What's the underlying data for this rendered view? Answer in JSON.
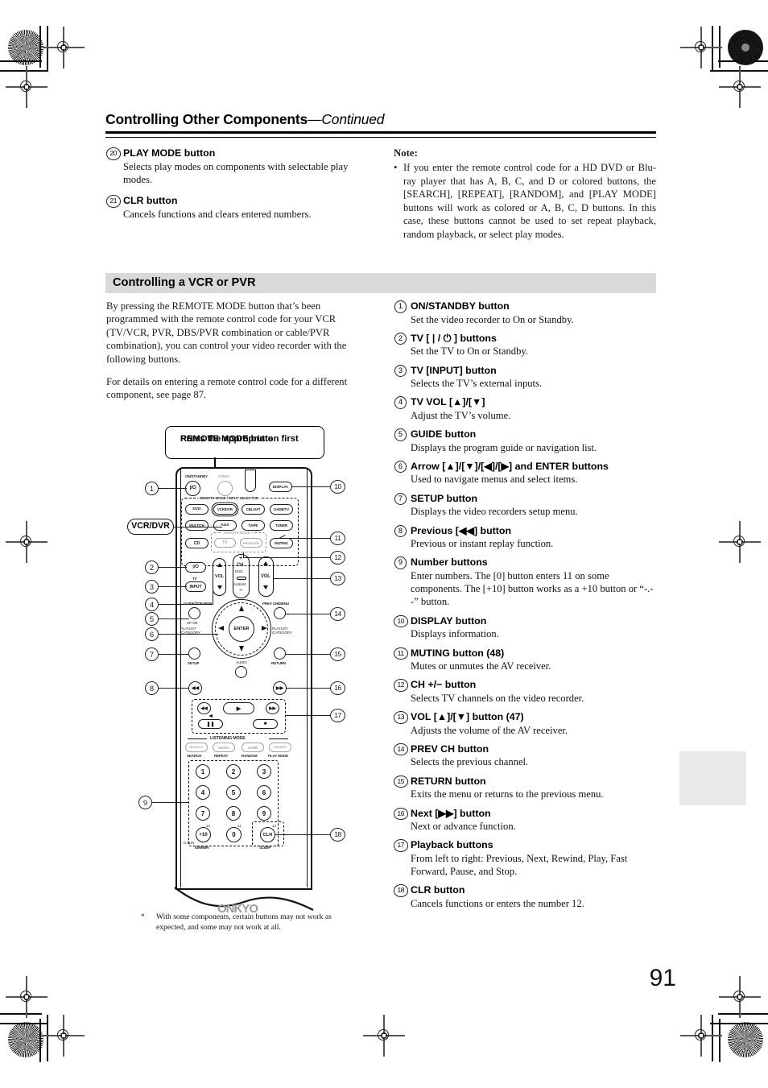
{
  "document": {
    "page_number": "91",
    "header_title": "Controlling Other Components",
    "header_continued": "—Continued"
  },
  "left_column": {
    "items": [
      {
        "num": "20",
        "heading": "PLAY MODE button",
        "desc": "Selects play modes on components with selectable play modes."
      },
      {
        "num": "21",
        "heading": "CLR button",
        "desc": "Cancels functions and clears entered numbers."
      }
    ]
  },
  "note": {
    "heading": "Note:",
    "bullet": "•",
    "text": "If you enter the remote control code for a HD DVD or Blu-ray player that has A, B, C, and D or colored buttons, the [SEARCH], [REPEAT], [RANDOM], and [PLAY MODE] buttons will work as colored or A, B, C, D buttons. In this case, these buttons cannot be used to set repeat playback, random playback, or select play modes."
  },
  "section": {
    "banner_title": "Controlling a VCR or PVR",
    "intro_p1": "By pressing the REMOTE MODE button that’s been programmed with the remote control code for your VCR (TV/VCR, PVR, DBS/PVR combination or cable/PVR combination), you can control your video recorder with the following buttons.",
    "intro_p2": "For details on entering a remote control code for a different component, see page 87."
  },
  "callout": {
    "line1": "Press the appropriate",
    "line2": "REMOTE MODE button first"
  },
  "vcr_tag": "VCR/DVR",
  "footnote": {
    "marker": "*",
    "text": "With some components, certain buttons may not work as expected, and some may not work at all."
  },
  "right_column": {
    "items": [
      {
        "num": "1",
        "heading": "ON/STANDBY button",
        "desc": "Set the video recorder to On or Standby."
      },
      {
        "num": "2",
        "heading": "TV [ | / ⏻ ] buttons",
        "desc": "Set the TV to On or Standby."
      },
      {
        "num": "3",
        "heading": "TV [INPUT] button",
        "desc": "Selects the TV’s external inputs."
      },
      {
        "num": "4",
        "heading": "TV VOL [▲]/[▼]",
        "desc": "Adjust the TV’s volume."
      },
      {
        "num": "5",
        "heading": "GUIDE button",
        "desc": "Displays the program guide or navigation list."
      },
      {
        "num": "6",
        "heading": "Arrow [▲]/[▼]/[◀]/[▶] and ENTER buttons",
        "desc": "Used to navigate menus and select items."
      },
      {
        "num": "7",
        "heading": "SETUP button",
        "desc": "Displays the video recorders setup menu."
      },
      {
        "num": "8",
        "heading": "Previous [◀◀] button",
        "desc": "Previous or instant replay function."
      },
      {
        "num": "9",
        "heading": "Number buttons",
        "desc": "Enter numbers. The [0] button enters 11 on some components. The [+10] button works as a +10 button or “-.--” button."
      },
      {
        "num": "10",
        "heading": "DISPLAY button",
        "desc": "Displays information."
      },
      {
        "num": "11",
        "heading": "MUTING button (48)",
        "desc": "Mutes or unmutes the AV receiver."
      },
      {
        "num": "12",
        "heading": "CH +/− button",
        "desc": "Selects TV channels on the video recorder."
      },
      {
        "num": "13",
        "heading": "VOL [▲]/[▼] button (47)",
        "desc": "Adjusts the volume of the AV receiver."
      },
      {
        "num": "14",
        "heading": "PREV CH button",
        "desc": "Selects the previous channel."
      },
      {
        "num": "15",
        "heading": "RETURN button",
        "desc": "Exits the menu or returns to the previous menu."
      },
      {
        "num": "16",
        "heading": "Next [▶▶] button",
        "desc": "Next or advance function."
      },
      {
        "num": "17",
        "heading": "Playback buttons",
        "desc": "From left to right: Previous, Next, Rewind, Play, Fast Forward, Pause, and Stop."
      },
      {
        "num": "18",
        "heading": "CLR button",
        "desc": "Cancels functions or enters the number 12."
      }
    ]
  },
  "remote": {
    "brand": "ONKYO",
    "labels": {
      "on_standby": "ON/STANDBY",
      "zone2": "ZONE2",
      "display": "DISPLAY",
      "remote_mode_input_selector": "REMOTE MODE / INPUT SELECTOR",
      "remote_mode": "REMOTE MODE",
      "tv": "TV",
      "input": "INPUT",
      "vol": "VOL",
      "ch": "CH",
      "disc": "DISC",
      "album": "ALBUM",
      "plus": "+",
      "minus": "−",
      "guide_top_menu": "GUIDE/TOP MENU",
      "sp_ab": "SP A/B",
      "prev_ch_menu": "PREV CH/MENU",
      "playlist_category": "PLAYLIST /CATEGORY",
      "enter": "ENTER",
      "setup": "SETUP",
      "return": "RETURN",
      "audio": "AUDIO",
      "listening_mode": "LISTENING MODE",
      "search": "SEARCH",
      "repeat": "REPEAT",
      "random": "RANDOM",
      "play_mode": "PLAY MODE",
      "dimmer": "DIMMER",
      "sleep": "SLEEP",
      "d_tun": "D.TUN",
      "ten": "10",
      "eleven": "11",
      "twelve": "12"
    },
    "source_buttons": [
      "DVD",
      "VCR/DVR",
      "CBL/SAT",
      "GAME/TV",
      "MULTICH",
      "AUX",
      "TAPE",
      "TUNER",
      "CD"
    ],
    "mode_buttons": [
      "TV",
      "RECEIVER"
    ],
    "muting": "MUTING",
    "listening_buttons": [
      "MOVIE/TV",
      "MUSIC",
      "GAME",
      "STEREO"
    ],
    "number_buttons": [
      "1",
      "2",
      "3",
      "4",
      "5",
      "6",
      "7",
      "8",
      "9",
      "+10",
      "0",
      "CLR"
    ],
    "power_glyph": "|/⏻"
  },
  "colors": {
    "banner_bg": "#d9d9d9",
    "thumb_tab": "#e9e9e9",
    "ink": "#111111",
    "grey_print": "#8f8f8f"
  }
}
